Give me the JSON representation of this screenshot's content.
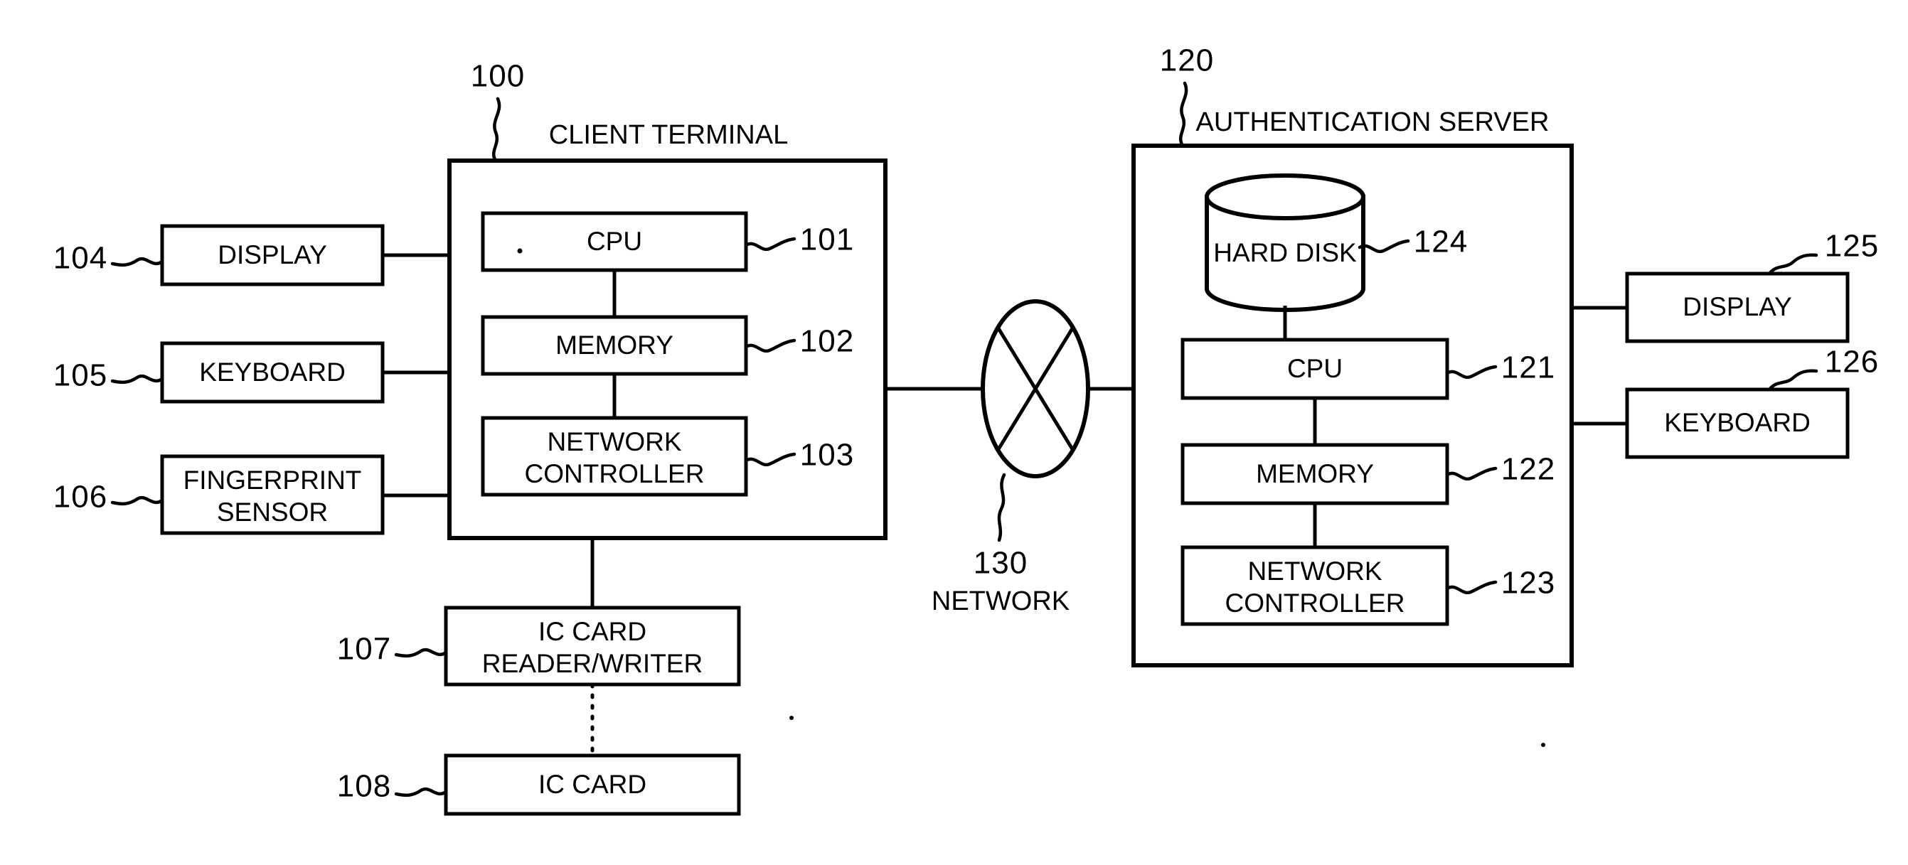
{
  "figure": {
    "kind": "system-block-diagram",
    "client": {
      "ref": "100",
      "title": "CLIENT TERMINAL",
      "components": [
        {
          "ref": "101",
          "label": "CPU"
        },
        {
          "ref": "102",
          "label": "MEMORY"
        },
        {
          "ref": "103",
          "label": "NETWORK CONTROLLER",
          "line1": "NETWORK",
          "line2": "CONTROLLER"
        }
      ],
      "peripherals": [
        {
          "ref": "104",
          "label": "DISPLAY"
        },
        {
          "ref": "105",
          "label": "KEYBOARD"
        },
        {
          "ref": "106",
          "label": "FINGERPRINT SENSOR",
          "line1": "FINGERPRINT",
          "line2": "SENSOR"
        },
        {
          "ref": "107",
          "label": "IC CARD READER/WRITER",
          "line1": "IC CARD",
          "line2": "READER/WRITER"
        },
        {
          "ref": "108",
          "label": "IC CARD"
        }
      ]
    },
    "network": {
      "ref": "130",
      "label": "NETWORK"
    },
    "server": {
      "ref": "120",
      "title": "AUTHENTICATION SERVER",
      "components": [
        {
          "ref": "124",
          "label": "HARD DISK"
        },
        {
          "ref": "121",
          "label": "CPU"
        },
        {
          "ref": "122",
          "label": "MEMORY"
        },
        {
          "ref": "123",
          "label": "NETWORK CONTROLLER",
          "line1": "NETWORK",
          "line2": "CONTROLLER"
        }
      ],
      "peripherals": [
        {
          "ref": "125",
          "label": "DISPLAY"
        },
        {
          "ref": "126",
          "label": "KEYBOARD"
        }
      ]
    },
    "colors": {
      "ink": "#000000",
      "paper": "#ffffff"
    }
  }
}
